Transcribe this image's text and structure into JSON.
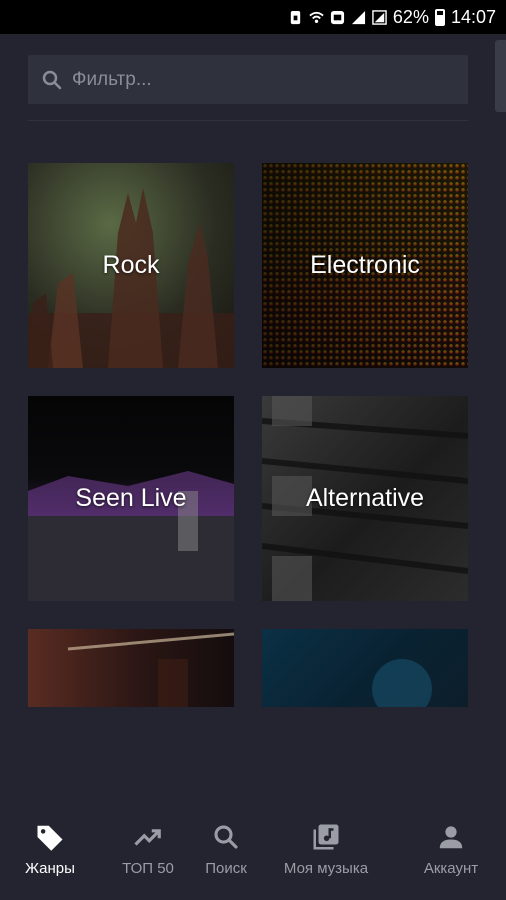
{
  "status_bar": {
    "battery": "62%",
    "time": "14:07",
    "icons": [
      "sim-icon",
      "wifi-icon",
      "data-icon",
      "signal-icon",
      "signal-icon-2",
      "battery-icon"
    ]
  },
  "search": {
    "placeholder": "Фильтр..."
  },
  "genres": [
    {
      "label": "Rock"
    },
    {
      "label": "Electronic"
    },
    {
      "label": "Seen Live"
    },
    {
      "label": "Alternative"
    },
    {
      "label": ""
    },
    {
      "label": ""
    }
  ],
  "nav": {
    "items": [
      {
        "label": "Жанры",
        "icon": "tag-icon",
        "active": true
      },
      {
        "label": "ТОП 50",
        "icon": "trending-icon",
        "active": false
      },
      {
        "label": "Поиск",
        "icon": "search-icon",
        "active": false
      },
      {
        "label": "Моя музыка",
        "icon": "library-music-icon",
        "active": false
      },
      {
        "label": "Аккаунт",
        "icon": "account-icon",
        "active": false
      }
    ]
  },
  "colors": {
    "background": "#23242f",
    "search_bg": "#2f313d",
    "nav_inactive": "#9a9ca6",
    "nav_active": "#ffffff"
  }
}
